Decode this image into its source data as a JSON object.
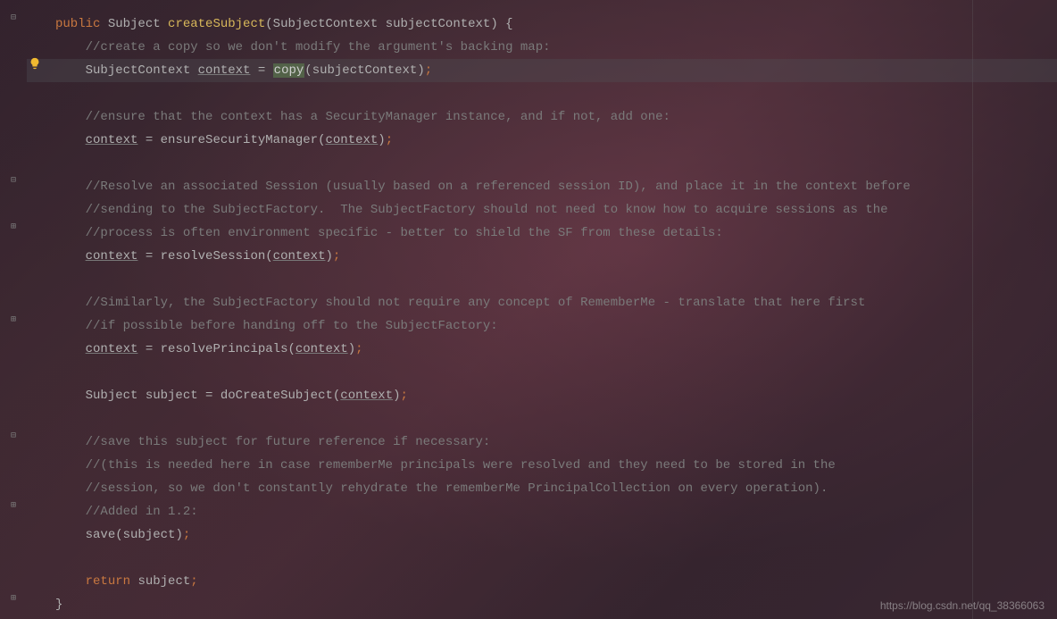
{
  "code": {
    "line1_public": "public",
    "line1_type": "Subject",
    "line1_method": "createSubject",
    "line1_param_type": "SubjectContext",
    "line1_param_name": "subjectContext",
    "line2_comment": "//create a copy so we don't modify the argument's backing map:",
    "line3_type": "SubjectContext",
    "line3_var": "context",
    "line3_copy": "copy",
    "line3_arg": "subjectContext",
    "line5_comment": "//ensure that the context has a SecurityManager instance, and if not, add one:",
    "line6_var": "context",
    "line6_call": "ensureSecurityManager",
    "line6_arg": "context",
    "line8_comment": "//Resolve an associated Session (usually based on a referenced session ID), and place it in the context before",
    "line9_comment": "//sending to the SubjectFactory.  The SubjectFactory should not need to know how to acquire sessions as the",
    "line10_comment": "//process is often environment specific - better to shield the SF from these details:",
    "line11_var": "context",
    "line11_call": "resolveSession",
    "line11_arg": "context",
    "line13_comment": "//Similarly, the SubjectFactory should not require any concept of RememberMe - translate that here first",
    "line14_comment": "//if possible before handing off to the SubjectFactory:",
    "line15_var": "context",
    "line15_call": "resolvePrincipals",
    "line15_arg": "context",
    "line17_type": "Subject",
    "line17_var": "subject",
    "line17_call": "doCreateSubject",
    "line17_arg": "context",
    "line19_comment": "//save this subject for future reference if necessary:",
    "line20_comment": "//(this is needed here in case rememberMe principals were resolved and they need to be stored in the",
    "line21_comment": "//session, so we don't constantly rehydrate the rememberMe PrincipalCollection on every operation).",
    "line22_comment": "//Added in 1.2:",
    "line23_call": "save",
    "line23_arg": "subject",
    "line25_return": "return",
    "line25_var": "subject"
  },
  "watermark": "https://blog.csdn.net/qq_38366063",
  "icons": {
    "bulb": "lightbulb-icon"
  }
}
